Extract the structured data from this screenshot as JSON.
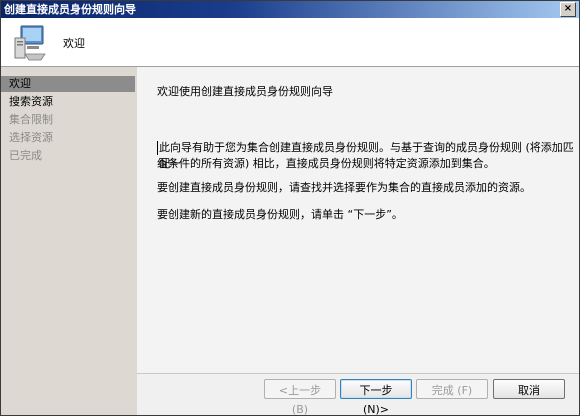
{
  "window": {
    "title": "创建直接成员身份规则向导",
    "close_glyph": "×"
  },
  "header": {
    "title": "欢迎",
    "icon": "computer-icon"
  },
  "sidebar": {
    "items": [
      {
        "label": "欢迎",
        "state": "selected"
      },
      {
        "label": "搜索资源",
        "state": "enabled"
      },
      {
        "label": "集合限制",
        "state": "disabled"
      },
      {
        "label": "选择资源",
        "state": "disabled"
      },
      {
        "label": "已完成",
        "state": "disabled"
      }
    ]
  },
  "content": {
    "heading": "欢迎使用创建直接成员身份规则向导",
    "para1_line1": "此向导有助于您为集合创建直接成员身份规则。与基于查询的成员身份规则 (将添加匹配一",
    "para1_line2": "组条件的所有资源) 相比，直接成员身份规则将特定资源添加到集合。",
    "para2": "要创建直接成员身份规则，请查找并选择要作为集合的直接成员添加的资源。",
    "para3": "要创建新的直接成员身份规则，请单击 “下一步”。"
  },
  "buttons": {
    "back": "<上一步 (B)",
    "next": "下一步 (N)>",
    "finish": "完成 (F)",
    "cancel": "取消"
  }
}
